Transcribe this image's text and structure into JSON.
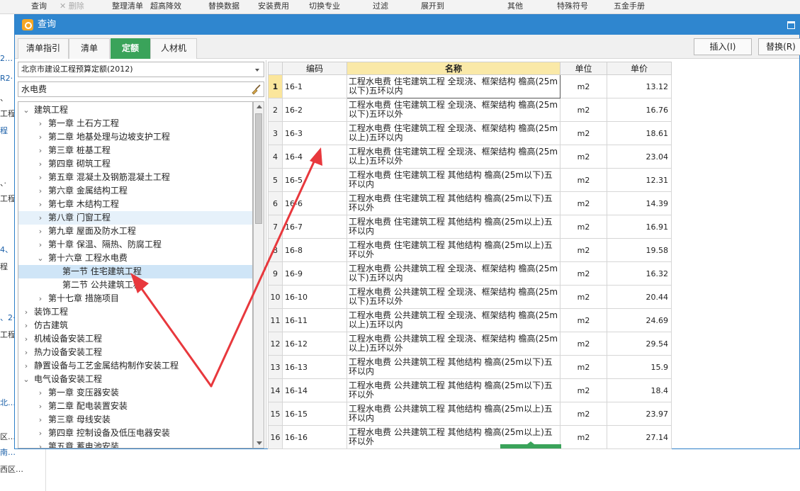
{
  "background": {
    "toolbar": [
      {
        "label": "查询"
      },
      {
        "label": "✕ 删除"
      },
      {
        "label": "整理清单"
      },
      {
        "label": "超高降效"
      },
      {
        "label": "替换数据"
      },
      {
        "label": "安装费用"
      },
      {
        "label": "切换专业"
      },
      {
        "label": "过滤"
      },
      {
        "label": "展开到"
      },
      {
        "label": "其他"
      },
      {
        "label": "特殊符号"
      },
      {
        "label": "五金手册"
      }
    ],
    "left_items": [
      {
        "label": "2…"
      },
      {
        "label": "R2·"
      },
      {
        "label": "、"
      },
      {
        "label": "工程"
      },
      {
        "label": "程"
      },
      {
        "label": "、·"
      },
      {
        "label": "工程"
      },
      {
        "label": "4、"
      },
      {
        "label": "程"
      },
      {
        "label": "、2·"
      },
      {
        "label": "工程"
      },
      {
        "label": "北…"
      }
    ],
    "bottom_items": [
      {
        "label": "区…"
      },
      {
        "label": "南…"
      },
      {
        "label": "西区…"
      }
    ]
  },
  "dialog": {
    "title": "查询",
    "tabs": [
      {
        "label": "清单指引",
        "active": false
      },
      {
        "label": "清单",
        "active": false
      },
      {
        "label": "定额",
        "active": true
      },
      {
        "label": "人材机",
        "active": false
      }
    ],
    "insert_label": "插入(I)",
    "replace_label": "替换(R)",
    "norm_library": "北京市建设工程预算定额(2012)",
    "search_value": "水电费",
    "tree": [
      {
        "label": "建筑工程",
        "level": 0,
        "expanded": true
      },
      {
        "label": "第一章 土石方工程",
        "level": 1,
        "expanded": false
      },
      {
        "label": "第二章 地基处理与边坡支护工程",
        "level": 1,
        "expanded": false
      },
      {
        "label": "第三章 桩基工程",
        "level": 1,
        "expanded": false
      },
      {
        "label": "第四章 砌筑工程",
        "level": 1,
        "expanded": false
      },
      {
        "label": "第五章 混凝土及钢筋混凝土工程",
        "level": 1,
        "expanded": false
      },
      {
        "label": "第六章 金属结构工程",
        "level": 1,
        "expanded": false
      },
      {
        "label": "第七章 木结构工程",
        "level": 1,
        "expanded": false
      },
      {
        "label": "第八章 门窗工程",
        "level": 1,
        "expanded": false,
        "hover": true
      },
      {
        "label": "第九章 屋面及防水工程",
        "level": 1,
        "expanded": false
      },
      {
        "label": "第十章 保温、隔热、防腐工程",
        "level": 1,
        "expanded": false
      },
      {
        "label": "第十六章 工程水电费",
        "level": 1,
        "expanded": true
      },
      {
        "label": "第一节 住宅建筑工程",
        "level": 2,
        "selected": true
      },
      {
        "label": "第二节 公共建筑工程",
        "level": 2
      },
      {
        "label": "第十七章 措施项目",
        "level": 1,
        "expanded": false
      },
      {
        "label": "装饰工程",
        "level": 0,
        "expanded": false
      },
      {
        "label": "仿古建筑",
        "level": 0,
        "expanded": false
      },
      {
        "label": "机械设备安装工程",
        "level": 0,
        "expanded": false
      },
      {
        "label": "热力设备安装工程",
        "level": 0,
        "expanded": false
      },
      {
        "label": "静置设备与工艺金属结构制作安装工程",
        "level": 0,
        "expanded": false
      },
      {
        "label": "电气设备安装工程",
        "level": 0,
        "expanded": true
      },
      {
        "label": "第一章 变压器安装",
        "level": 1,
        "expanded": false
      },
      {
        "label": "第二章 配电装置安装",
        "level": 1,
        "expanded": false
      },
      {
        "label": "第三章 母线安装",
        "level": 1,
        "expanded": false
      },
      {
        "label": "第四章 控制设备及低压电器安装",
        "level": 1,
        "expanded": false
      },
      {
        "label": "第五章 蓄电池安装",
        "level": 1,
        "expanded": false
      }
    ],
    "table": {
      "columns": {
        "code": "编码",
        "name": "名称",
        "unit": "单位",
        "price": "单价"
      },
      "rows": [
        {
          "no": "1",
          "code": "16-1",
          "name": "工程水电费 住宅建筑工程 全现浇、框架结构 檐高(25m以下)五环以内",
          "unit": "m2",
          "price": "13.12"
        },
        {
          "no": "2",
          "code": "16-2",
          "name": "工程水电费 住宅建筑工程 全现浇、框架结构 檐高(25m以下)五环以外",
          "unit": "m2",
          "price": "16.76"
        },
        {
          "no": "3",
          "code": "16-3",
          "name": "工程水电费 住宅建筑工程 全现浇、框架结构 檐高(25m以上)五环以内",
          "unit": "m2",
          "price": "18.61"
        },
        {
          "no": "4",
          "code": "16-4",
          "name": "工程水电费 住宅建筑工程 全现浇、框架结构 檐高(25m以上)五环以外",
          "unit": "m2",
          "price": "23.04"
        },
        {
          "no": "5",
          "code": "16-5",
          "name": "工程水电费 住宅建筑工程 其他结构 檐高(25m以下)五环以内",
          "unit": "m2",
          "price": "12.31"
        },
        {
          "no": "6",
          "code": "16-6",
          "name": "工程水电费 住宅建筑工程 其他结构 檐高(25m以下)五环以外",
          "unit": "m2",
          "price": "14.39"
        },
        {
          "no": "7",
          "code": "16-7",
          "name": "工程水电费 住宅建筑工程 其他结构 檐高(25m以上)五环以内",
          "unit": "m2",
          "price": "16.91"
        },
        {
          "no": "8",
          "code": "16-8",
          "name": "工程水电费 住宅建筑工程 其他结构 檐高(25m以上)五环以外",
          "unit": "m2",
          "price": "19.58"
        },
        {
          "no": "9",
          "code": "16-9",
          "name": "工程水电费 公共建筑工程 全现浇、框架结构 檐高(25m以下)五环以内",
          "unit": "m2",
          "price": "16.32"
        },
        {
          "no": "10",
          "code": "16-10",
          "name": "工程水电费 公共建筑工程 全现浇、框架结构 檐高(25m以下)五环以外",
          "unit": "m2",
          "price": "20.44"
        },
        {
          "no": "11",
          "code": "16-11",
          "name": "工程水电费 公共建筑工程 全现浇、框架结构 檐高(25m以上)五环以内",
          "unit": "m2",
          "price": "24.69"
        },
        {
          "no": "12",
          "code": "16-12",
          "name": "工程水电费 公共建筑工程 全现浇、框架结构 檐高(25m以上)五环以外",
          "unit": "m2",
          "price": "29.54"
        },
        {
          "no": "13",
          "code": "16-13",
          "name": "工程水电费 公共建筑工程 其他结构 檐高(25m以下)五环以内",
          "unit": "m2",
          "price": "15.9"
        },
        {
          "no": "14",
          "code": "16-14",
          "name": "工程水电费 公共建筑工程 其他结构 檐高(25m以下)五环以外",
          "unit": "m2",
          "price": "18.4"
        },
        {
          "no": "15",
          "code": "16-15",
          "name": "工程水电费 公共建筑工程 其他结构 檐高(25m以上)五环以内",
          "unit": "m2",
          "price": "23.97"
        },
        {
          "no": "16",
          "code": "16-16",
          "name": "工程水电费 公共建筑工程 其他结构 檐高(25m以上)五环以外",
          "unit": "m2",
          "price": "27.14"
        }
      ]
    }
  },
  "colors": {
    "titlebar": "#2f86cf",
    "active_tab": "#3aa35a",
    "name_header": "#fae9a8",
    "selected_row_number": "#fbe69c",
    "annotation_arrow": "#e8383d"
  }
}
